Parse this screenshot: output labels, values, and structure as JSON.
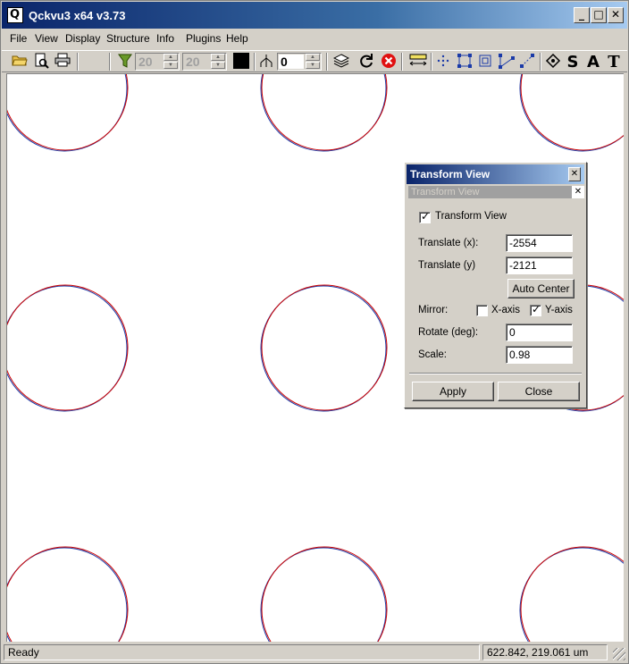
{
  "window": {
    "title": "Qckvu3 x64 v3.73"
  },
  "menu": [
    "File",
    "View",
    "Display",
    "Structure",
    "Info",
    "Plugins",
    "Help"
  ],
  "toolbar": {
    "spin1_value": "20",
    "spin2_value": "20",
    "spin3_value": "0"
  },
  "dialog": {
    "title": "Transform View",
    "subtitle": "Transform View",
    "transform_view_label": "Transform View",
    "transform_view_checked": true,
    "translate_x_label": "Translate (x):",
    "translate_x_value": "-2554",
    "translate_y_label": "Translate (y)",
    "translate_y_value": "-2121",
    "auto_center_label": "Auto Center",
    "mirror_label": "Mirror:",
    "x_axis_label": "X-axis",
    "x_axis_checked": false,
    "y_axis_label": "Y-axis",
    "y_axis_checked": true,
    "rotate_label": "Rotate (deg):",
    "rotate_value": "0",
    "scale_label": "Scale:",
    "scale_value": "0.98",
    "apply_label": "Apply",
    "close_label": "Close"
  },
  "status": {
    "left": "Ready",
    "coords": "622.842, 219.061 um"
  },
  "colors": {
    "title_start": "#0a246a",
    "title_end": "#a6caf0",
    "circle_red": "#cc0000",
    "circle_blue": "#1a3aa8"
  }
}
